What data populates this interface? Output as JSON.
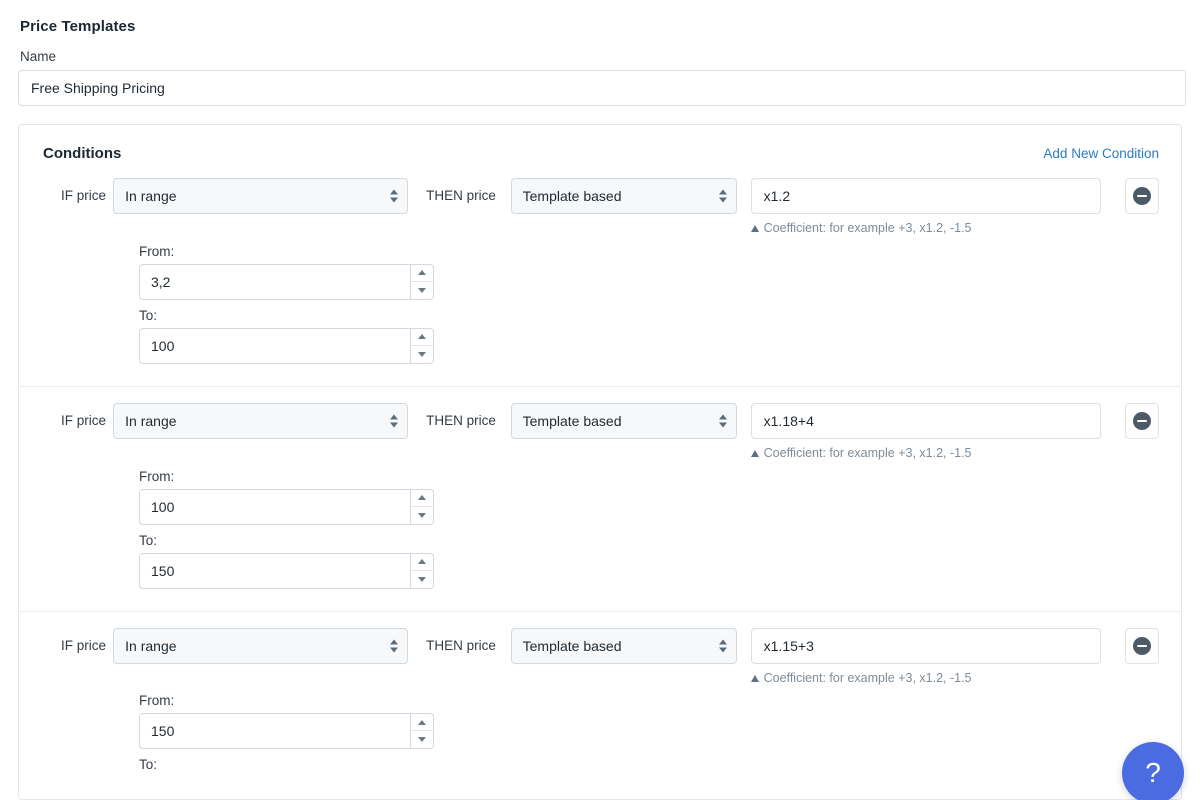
{
  "page": {
    "title": "Price Templates",
    "name_label": "Name",
    "name_value": "Free Shipping Pricing"
  },
  "conditions_card": {
    "title": "Conditions",
    "add_link": "Add New Condition",
    "labels": {
      "if_price": "IF price",
      "then_price": "THEN price",
      "from": "From:",
      "to": "To:",
      "coefficient_hint": "Coefficient: for example +3, x1.2, -1.5",
      "remove_icon": "minus-circle-icon"
    },
    "rows": [
      {
        "condition_type": "In range",
        "then_type": "Template based",
        "coefficient": "x1.2",
        "from": "3,2",
        "to": "100"
      },
      {
        "condition_type": "In range",
        "then_type": "Template based",
        "coefficient": "x1.18+4",
        "from": "100",
        "to": "150"
      },
      {
        "condition_type": "In range",
        "then_type": "Template based",
        "coefficient": "x1.15+3",
        "from": "150",
        "to": ""
      }
    ]
  },
  "help": {
    "label": "?",
    "icon": "question-mark-icon",
    "color": "#4a6ce0"
  },
  "colors": {
    "link": "#2b7cc4",
    "hint_text": "#7d8c99",
    "border": "#e3e8ec",
    "input_border": "#d2dae1"
  }
}
